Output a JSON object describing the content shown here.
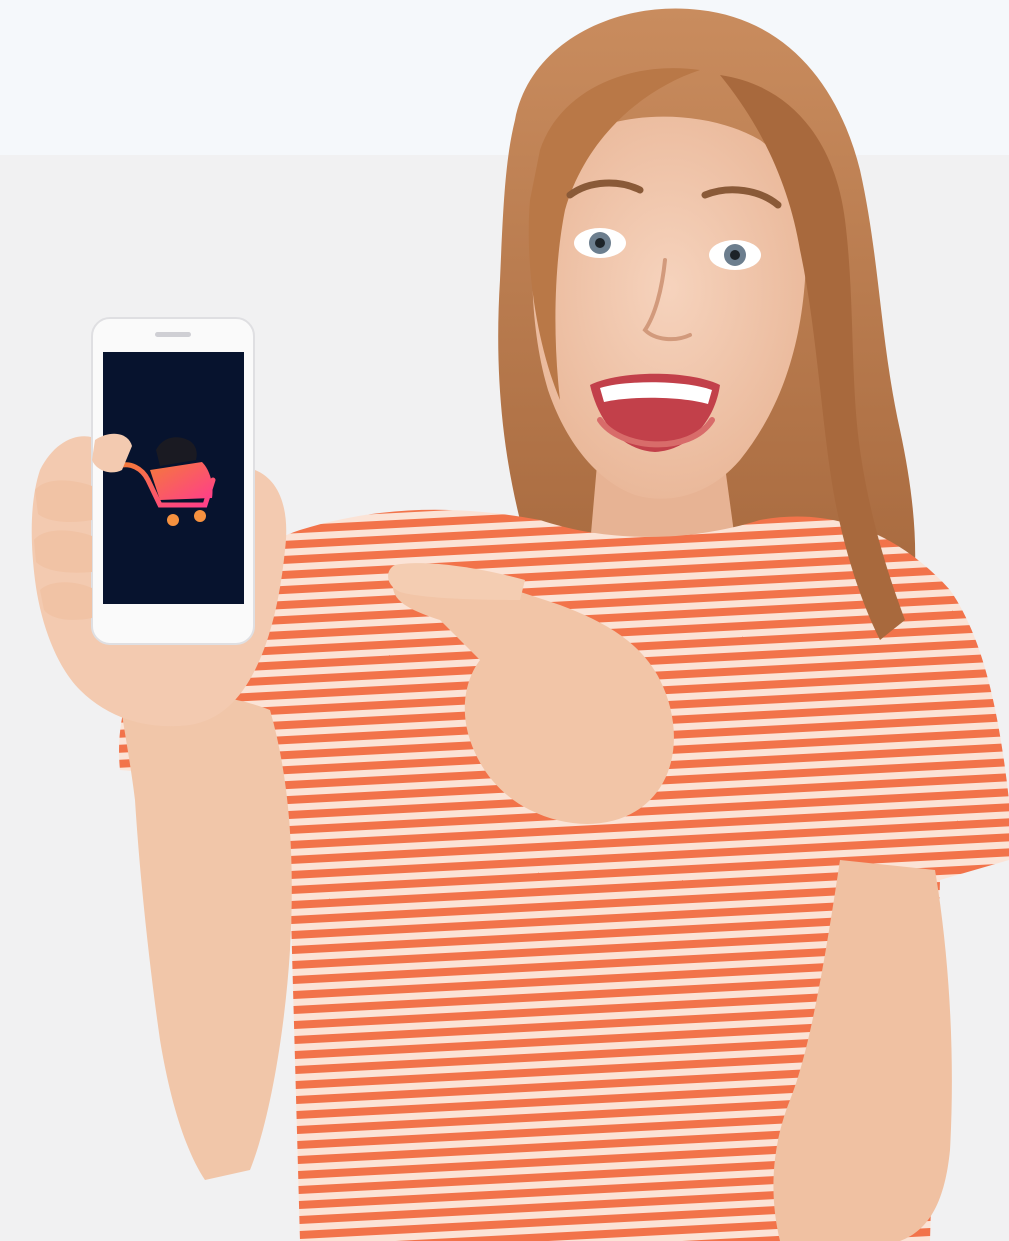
{
  "photo": {
    "subject": "woman-holding-phone",
    "colors": {
      "background_top": "#f5f8fb",
      "background_bottom": "#f1f1f2",
      "hair": "#b9784a",
      "skin": "#f2c9ae",
      "shirt_stripe": "#f2734a",
      "shirt_base": "#fbe3d6",
      "phone_body": "#fafafa",
      "phone_screen": "#07132e",
      "logo_gradient_start": "#f47a3a",
      "logo_gradient_end": "#ff3e8a"
    },
    "icons": [
      "shopping-cart-logo-icon"
    ]
  }
}
